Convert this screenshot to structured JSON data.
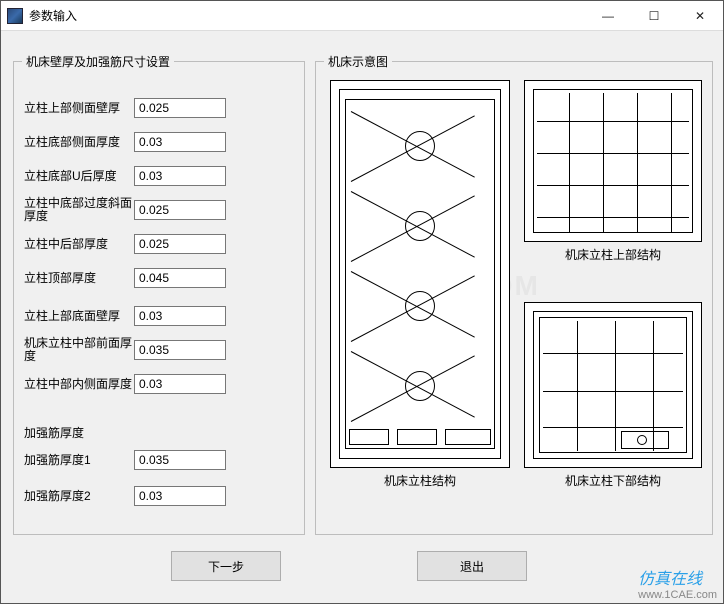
{
  "window": {
    "title": "参数输入",
    "minimize": "—",
    "maximize": "☐",
    "close": "✕"
  },
  "group_left": {
    "legend": "机床壁厚及加强筋尺寸设置"
  },
  "group_right": {
    "legend": "机床示意图"
  },
  "fields": [
    {
      "label": "立柱上部侧面壁厚",
      "value": "0.025"
    },
    {
      "label": "立柱底部侧面厚度",
      "value": "0.03"
    },
    {
      "label": "立柱底部U后厚度",
      "value": "0.03"
    },
    {
      "label": "立柱中底部过度斜面厚度",
      "value": "0.025"
    },
    {
      "label": "立柱中后部厚度",
      "value": "0.025"
    },
    {
      "label": "立柱顶部厚度",
      "value": "0.045"
    },
    {
      "label": "立柱上部底面壁厚",
      "value": "0.03"
    },
    {
      "label": "机床立柱中部前面厚度",
      "value": "0.035"
    },
    {
      "label": "立柱中部内侧面厚度",
      "value": "0.03"
    }
  ],
  "rib_header": "加强筋厚度",
  "rib_fields": [
    {
      "label": "加强筋厚度1",
      "value": "0.035"
    },
    {
      "label": "加强筋厚度2",
      "value": "0.03"
    }
  ],
  "captions": {
    "main": "机床立柱结构",
    "top": "机床立柱上部结构",
    "bottom": "机床立柱下部结构"
  },
  "buttons": {
    "next": "下一步",
    "exit": "退出"
  },
  "watermark": {
    "brand": "仿真在线",
    "url": "www.1CAE.com"
  }
}
